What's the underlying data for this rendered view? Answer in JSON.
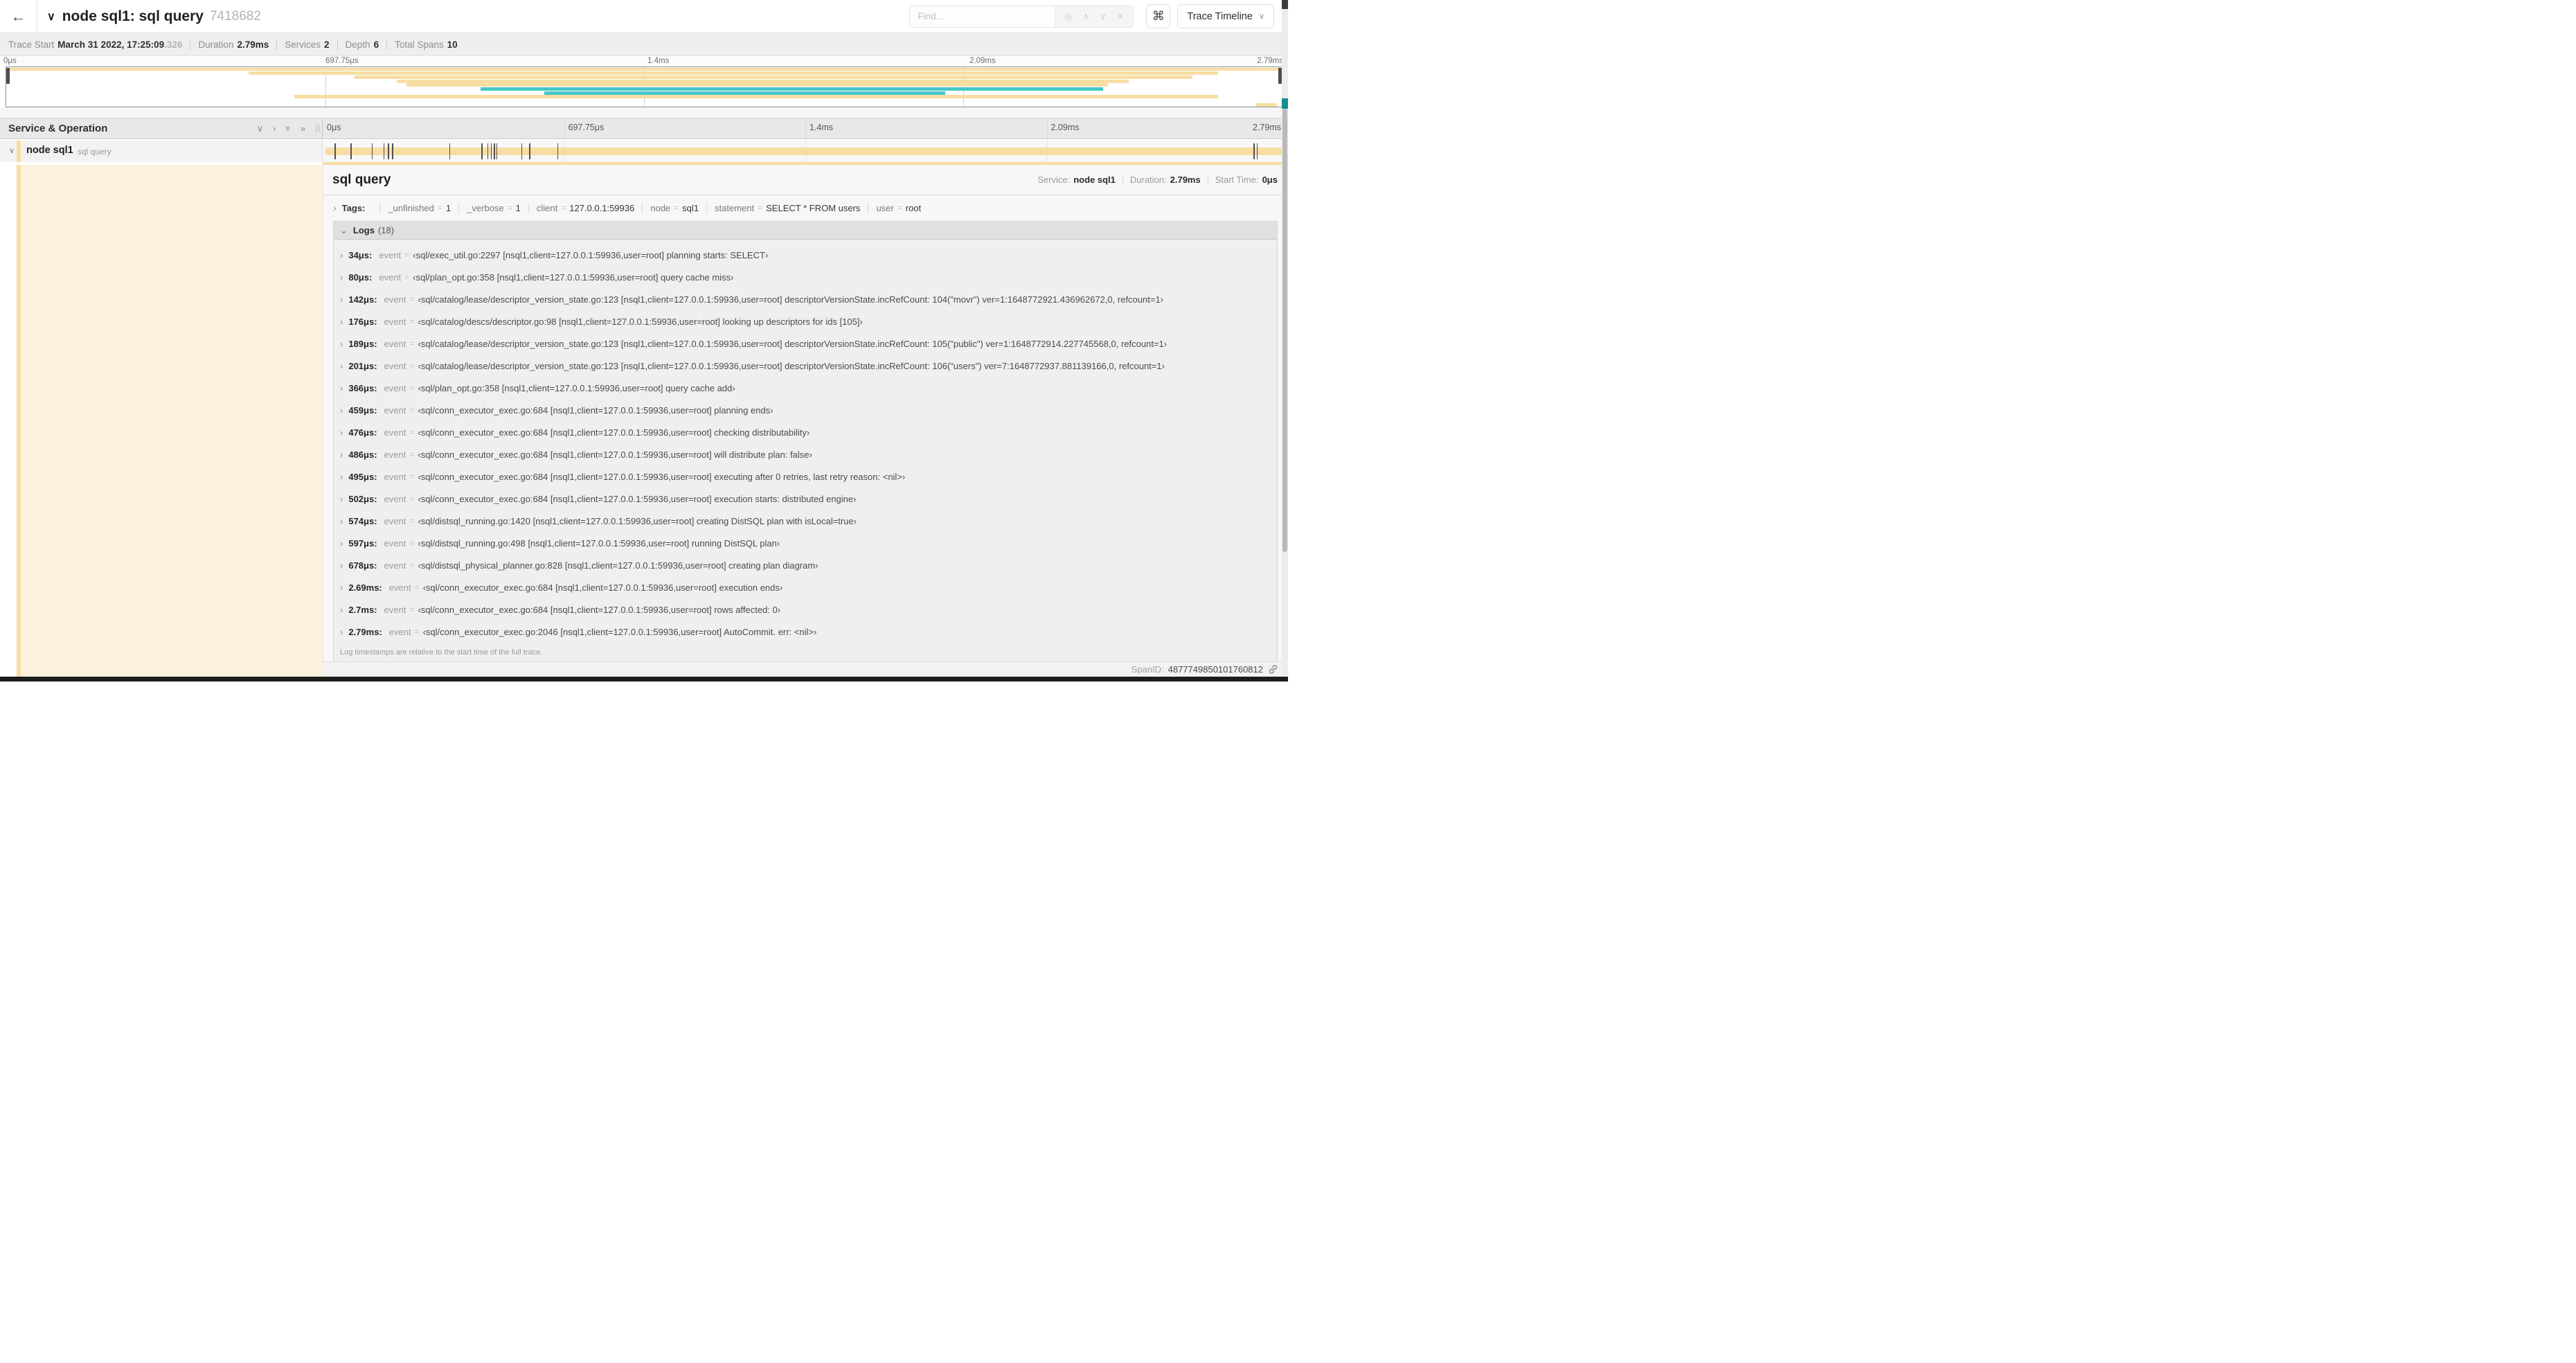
{
  "colors": {
    "tan": "#F8DDA3",
    "teal": "#46C7CA",
    "cream": "#FBF2DE"
  },
  "icons": {
    "back": "←",
    "chevron_down_bold": "∨",
    "target": "◎",
    "up": "∧",
    "down": "∨",
    "close": "✕",
    "command": "⌘",
    "caret": "∨",
    "collapse_one": "∨",
    "expand_one": "›",
    "collapse_all": "»",
    "expand_all": "»",
    "drag_handle": "||",
    "chevron_right": "›",
    "chevron_down": "⌄",
    "eq": "="
  },
  "topnav": {
    "title": "node sql1: sql query",
    "trace_id": "7418682",
    "find_placeholder": "Find...",
    "view_selector": "Trace Timeline"
  },
  "summary": {
    "items": [
      {
        "label": "Trace Start",
        "value": "March 31 2022, 17:25:09",
        "suffix": ".326"
      },
      {
        "label": "Duration",
        "value": "2.79ms",
        "suffix": ""
      },
      {
        "label": "Services",
        "value": "2",
        "suffix": ""
      },
      {
        "label": "Depth",
        "value": "6",
        "suffix": ""
      },
      {
        "label": "Total Spans",
        "value": "10",
        "suffix": ""
      }
    ]
  },
  "ruler": {
    "ticks": [
      {
        "label": "0μs",
        "pct": 0
      },
      {
        "label": "697.75μs",
        "pct": 25
      },
      {
        "label": "1.4ms",
        "pct": 50
      },
      {
        "label": "2.09ms",
        "pct": 75
      }
    ],
    "end_label": "2.79ms"
  },
  "minimap": {
    "spans": [
      {
        "row_pct": 1,
        "start": 0,
        "width": 100,
        "color": "#F8DDA3"
      },
      {
        "row_pct": 11,
        "start": 19,
        "width": 76,
        "color": "#F8DDA3"
      },
      {
        "row_pct": 21,
        "start": 27.3,
        "width": 65.7,
        "color": "#F8DDA3"
      },
      {
        "row_pct": 31,
        "start": 30.6,
        "width": 57.4,
        "color": "#F8DDA3"
      },
      {
        "row_pct": 41,
        "start": 31.4,
        "width": 55,
        "color": "#F8DDA3"
      },
      {
        "row_pct": 51,
        "start": 37.2,
        "width": 48.8,
        "color": "#46C7CA"
      },
      {
        "row_pct": 61,
        "start": 42.2,
        "width": 31.4,
        "color": "#46C7CA"
      },
      {
        "row_pct": 71,
        "start": 22.6,
        "width": 72.4,
        "color": "#F8DDA3"
      },
      {
        "row_pct": 91,
        "start": 98,
        "width": 1.6,
        "color": "#F8DDA3"
      }
    ]
  },
  "grid": {
    "header_title": "Service & Operation",
    "ticks": [
      {
        "label": "0μs",
        "pct": 0
      },
      {
        "label": "697.75μs",
        "pct": 25
      },
      {
        "label": "1.4ms",
        "pct": 50
      },
      {
        "label": "2.09ms",
        "pct": 75
      }
    ],
    "end_label": "2.79ms"
  },
  "span_row": {
    "service": "node sql1",
    "operation": "sql query",
    "bar_color": "#F8DDA3",
    "log_ticks": [
      {
        "pct": 1.22
      },
      {
        "pct": 2.87
      },
      {
        "pct": 5.09
      },
      {
        "pct": 6.31
      },
      {
        "pct": 6.77
      },
      {
        "pct": 7.2
      },
      {
        "pct": 13.12
      },
      {
        "pct": 16.45
      },
      {
        "pct": 17.06
      },
      {
        "pct": 17.42
      },
      {
        "pct": 17.74
      },
      {
        "pct": 18.0
      },
      {
        "pct": 20.57
      },
      {
        "pct": 21.4
      },
      {
        "pct": 24.3
      },
      {
        "pct": 96.42
      },
      {
        "pct": 96.77
      }
    ]
  },
  "detail": {
    "title": "sql query",
    "meta": [
      {
        "label": "Service:",
        "value": "node sql1"
      },
      {
        "label": "Duration:",
        "value": "2.79ms"
      },
      {
        "label": "Start Time:",
        "value": "0μs"
      }
    ],
    "tags_label": "Tags:",
    "tags": [
      {
        "key": "_unfinished",
        "value": "1"
      },
      {
        "key": "_verbose",
        "value": "1"
      },
      {
        "key": "client",
        "value": "127.0.0.1:59936"
      },
      {
        "key": "node",
        "value": "sql1"
      },
      {
        "key": "statement",
        "value": "SELECT * FROM users"
      },
      {
        "key": "user",
        "value": "root"
      }
    ],
    "logs_label": "Logs",
    "logs_count": "(18)",
    "log_key": "event",
    "logs": [
      {
        "t": "34μs:",
        "value": "‹sql/exec_util.go:2297 [nsql1,client=127.0.0.1:59936,user=root] planning starts: SELECT›"
      },
      {
        "t": "80μs:",
        "value": "‹sql/plan_opt.go:358 [nsql1,client=127.0.0.1:59936,user=root] query cache miss›"
      },
      {
        "t": "142μs:",
        "value": "‹sql/catalog/lease/descriptor_version_state.go:123 [nsql1,client=127.0.0.1:59936,user=root] descriptorVersionState.incRefCount: 104(\"movr\") ver=1:1648772921.436962672,0, refcount=1›"
      },
      {
        "t": "176μs:",
        "value": "‹sql/catalog/descs/descriptor.go:98 [nsql1,client=127.0.0.1:59936,user=root] looking up descriptors for ids [105]›"
      },
      {
        "t": "189μs:",
        "value": "‹sql/catalog/lease/descriptor_version_state.go:123 [nsql1,client=127.0.0.1:59936,user=root] descriptorVersionState.incRefCount: 105(\"public\") ver=1:1648772914.227745568,0, refcount=1›"
      },
      {
        "t": "201μs:",
        "value": "‹sql/catalog/lease/descriptor_version_state.go:123 [nsql1,client=127.0.0.1:59936,user=root] descriptorVersionState.incRefCount: 106(\"users\") ver=7:1648772937.881139166,0, refcount=1›"
      },
      {
        "t": "366μs:",
        "value": "‹sql/plan_opt.go:358 [nsql1,client=127.0.0.1:59936,user=root] query cache add›"
      },
      {
        "t": "459μs:",
        "value": "‹sql/conn_executor_exec.go:684 [nsql1,client=127.0.0.1:59936,user=root] planning ends›"
      },
      {
        "t": "476μs:",
        "value": "‹sql/conn_executor_exec.go:684 [nsql1,client=127.0.0.1:59936,user=root] checking distributability›"
      },
      {
        "t": "486μs:",
        "value": "‹sql/conn_executor_exec.go:684 [nsql1,client=127.0.0.1:59936,user=root] will distribute plan: false›"
      },
      {
        "t": "495μs:",
        "value": "‹sql/conn_executor_exec.go:684 [nsql1,client=127.0.0.1:59936,user=root] executing after 0 retries, last retry reason: <nil>›"
      },
      {
        "t": "502μs:",
        "value": "‹sql/conn_executor_exec.go:684 [nsql1,client=127.0.0.1:59936,user=root] execution starts: distributed engine›"
      },
      {
        "t": "574μs:",
        "value": "‹sql/distsql_running.go:1420 [nsql1,client=127.0.0.1:59936,user=root] creating DistSQL plan with isLocal=true›"
      },
      {
        "t": "597μs:",
        "value": "‹sql/distsql_running.go:498 [nsql1,client=127.0.0.1:59936,user=root] running DistSQL plan›"
      },
      {
        "t": "678μs:",
        "value": "‹sql/distsql_physical_planner.go:828 [nsql1,client=127.0.0.1:59936,user=root] creating plan diagram›"
      },
      {
        "t": "2.69ms:",
        "value": "‹sql/conn_executor_exec.go:684 [nsql1,client=127.0.0.1:59936,user=root] execution ends›"
      },
      {
        "t": "2.7ms:",
        "value": "‹sql/conn_executor_exec.go:684 [nsql1,client=127.0.0.1:59936,user=root] rows affected: 0›"
      },
      {
        "t": "2.79ms:",
        "value": "‹sql/conn_executor_exec.go:2046 [nsql1,client=127.0.0.1:59936,user=root] AutoCommit. err: <nil>›"
      }
    ],
    "footnote": "Log timestamps are relative to the start time of the full trace.",
    "footer_label": "SpanID:",
    "footer_value": "4877749850101760812"
  }
}
